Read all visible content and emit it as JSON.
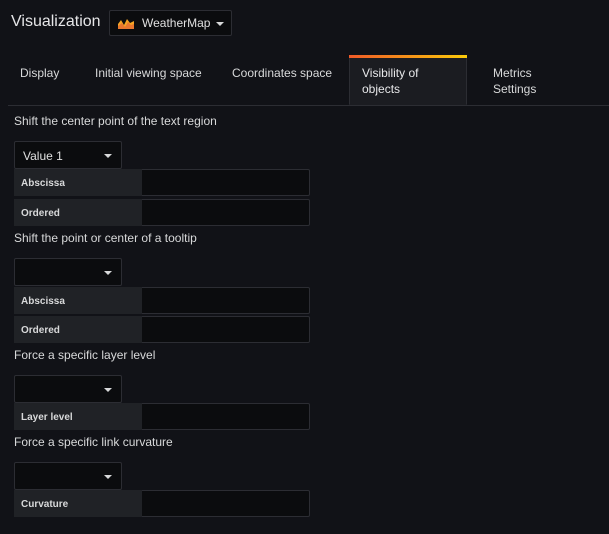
{
  "header": {
    "title": "Visualization",
    "plugin": {
      "name": "WeatherMap",
      "icon": "weathermap-chart-icon"
    }
  },
  "tabs": [
    {
      "label": "Display",
      "active": false
    },
    {
      "label": "Initial viewing space",
      "active": false
    },
    {
      "label": "Coordinates space",
      "active": false
    },
    {
      "label": "Visibility of objects",
      "active": true
    },
    {
      "label": "Metrics Settings",
      "active": false
    }
  ],
  "sections": {
    "text_region": {
      "label": "Shift the center point of the text region",
      "select_value": "Value 1",
      "abscissa_label": "Abscissa",
      "abscissa_value": "",
      "ordered_label": "Ordered",
      "ordered_value": ""
    },
    "tooltip": {
      "label": "Shift the point or center of a tooltip",
      "select_value": "",
      "abscissa_label": "Abscissa",
      "abscissa_value": "",
      "ordered_label": "Ordered",
      "ordered_value": ""
    },
    "layer": {
      "label": "Force a specific layer level",
      "select_value": "",
      "field_label": "Layer level",
      "field_value": ""
    },
    "curvature": {
      "label": "Force a specific link curvature",
      "select_value": "",
      "field_label": "Curvature",
      "field_value": ""
    }
  },
  "colors": {
    "background": "#111217",
    "active_tab_gradient_start": "#f05a28",
    "active_tab_gradient_end": "#fbca0a"
  }
}
